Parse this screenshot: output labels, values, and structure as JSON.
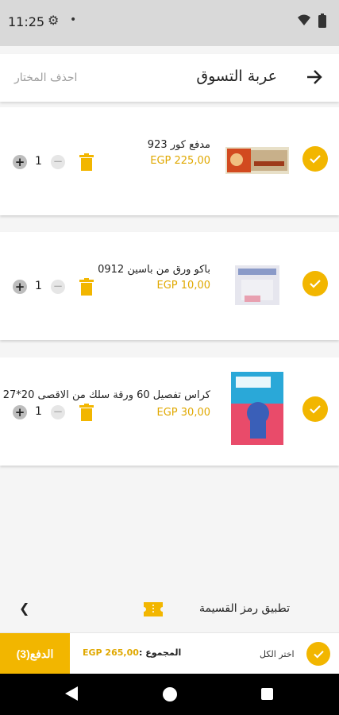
{
  "status_bar": {
    "time": "11:25",
    "settings_icon": "gear-icon",
    "notification_icon": "dot-icon"
  },
  "header": {
    "title": "عربة التسوق",
    "delete_selected": "احذف المختار",
    "back_icon": "arrow-right-icon"
  },
  "cart_items": [
    {
      "title": "مدفع كور 923",
      "price": "EGP 225,00",
      "quantity": "1",
      "selected": true
    },
    {
      "title": "باكو ورق من باسين 0912",
      "price": "EGP 10,00",
      "quantity": "1",
      "selected": true
    },
    {
      "title": "كراس تفصيل 60 ورقة سلك من الاقصى 20*27",
      "price": "EGP 30,00",
      "quantity": "1",
      "selected": true
    }
  ],
  "coupon": {
    "label": "تطبيق رمز القسيمة"
  },
  "footer": {
    "select_all": "اختر الكل",
    "total_label": "المجموع :",
    "total_value": "EGP 265,00",
    "pay_button": "الدفع(3)"
  },
  "colors": {
    "accent": "#f2b600",
    "price": "#e0a800"
  }
}
